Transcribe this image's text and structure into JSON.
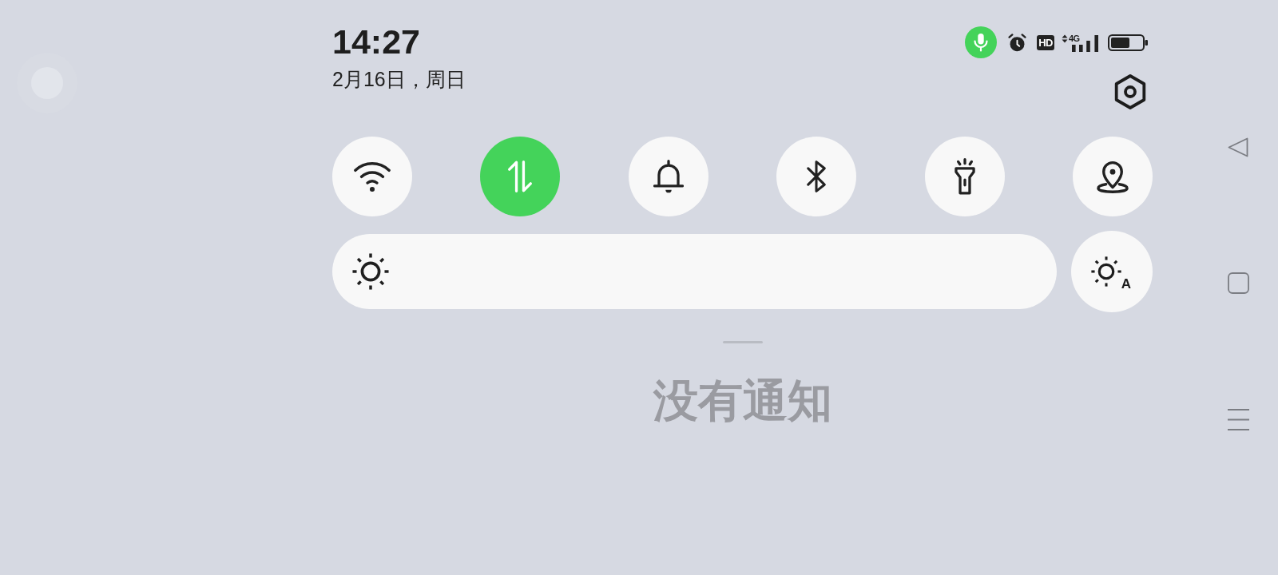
{
  "status_bar": {
    "time": "14:27",
    "date": "2月16日，周日",
    "hd_badge": "HD",
    "network_type": "4G"
  },
  "quick_toggles": [
    {
      "kind": "wifi",
      "on": false
    },
    {
      "kind": "mobile-data",
      "on": true
    },
    {
      "kind": "sound",
      "on": false
    },
    {
      "kind": "bluetooth",
      "on": false
    },
    {
      "kind": "flashlight",
      "on": false
    },
    {
      "kind": "location",
      "on": false
    }
  ],
  "brightness": {
    "level": 1
  },
  "auto_brightness": {
    "on": false,
    "label": "A"
  },
  "notifications": {
    "empty_text": "没有通知"
  }
}
